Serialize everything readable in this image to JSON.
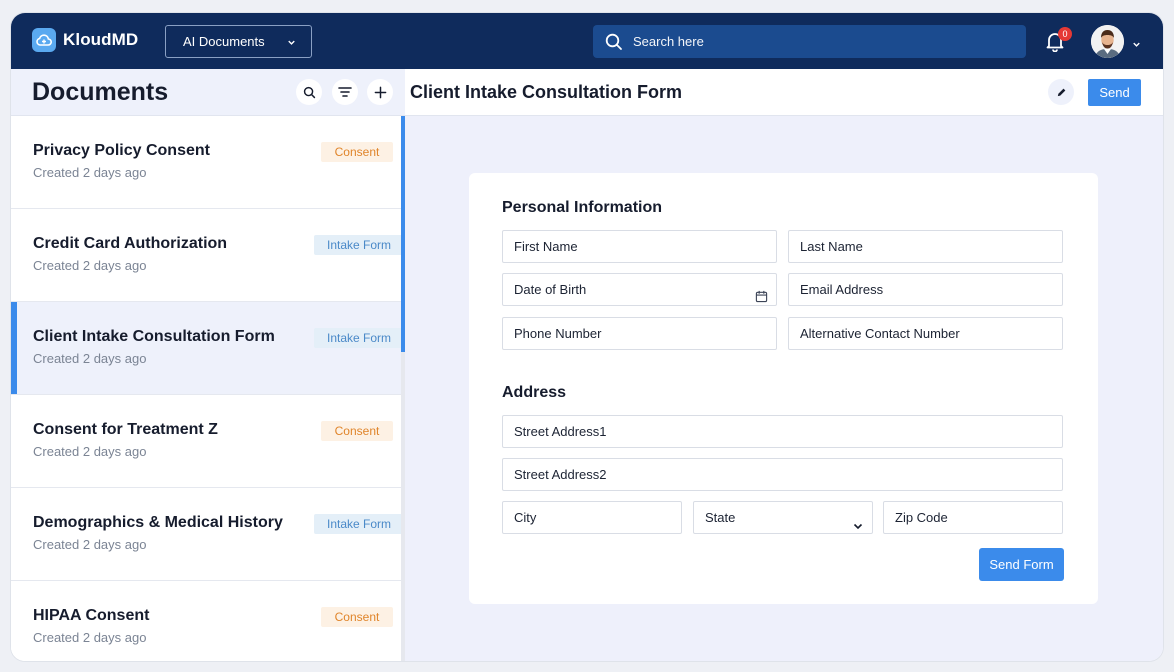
{
  "app": {
    "name": "KloudMD"
  },
  "header": {
    "doc_filter": "AI Documents",
    "search_placeholder": "Search here",
    "notifications_count": "0"
  },
  "sidebar": {
    "title": "Documents",
    "items": [
      {
        "name": "Privacy Policy Consent",
        "date": "Created 2 days ago",
        "tag": "Consent",
        "tag_type": "consent",
        "active": false
      },
      {
        "name": "Credit Card Authorization",
        "date": "Created 2 days ago",
        "tag": "Intake Form",
        "tag_type": "intake",
        "active": false
      },
      {
        "name": "Client Intake Consultation Form",
        "date": "Created 2 days ago",
        "tag": "Intake Form",
        "tag_type": "intake",
        "active": true
      },
      {
        "name": "Consent for Treatment Z",
        "date": "Created 2 days ago",
        "tag": "Consent",
        "tag_type": "consent",
        "active": false
      },
      {
        "name": "Demographics & Medical History",
        "date": "Created 2 days ago",
        "tag": "Intake Form",
        "tag_type": "intake",
        "active": false
      },
      {
        "name": "HIPAA Consent",
        "date": "Created 2 days ago",
        "tag": "Consent",
        "tag_type": "consent",
        "active": false
      }
    ]
  },
  "form": {
    "title": "Client Intake Consultation Form",
    "send_label": "Send",
    "personal_section": "Personal Information",
    "first_name": "First Name",
    "last_name": "Last Name",
    "dob": "Date of Birth",
    "email": "Email Address",
    "phone": "Phone Number",
    "alt_phone": "Alternative Contact Number",
    "address_section": "Address",
    "street1": "Street Address1",
    "street2": "Street Address2",
    "city": "City",
    "state": "State",
    "zip": "Zip Code",
    "send_form_label": "Send Form"
  },
  "colors": {
    "topbar": "#0f2b5c",
    "accent": "#3b8beb",
    "consent_tag": "#e0852b",
    "intake_tag": "#4a89c8"
  }
}
